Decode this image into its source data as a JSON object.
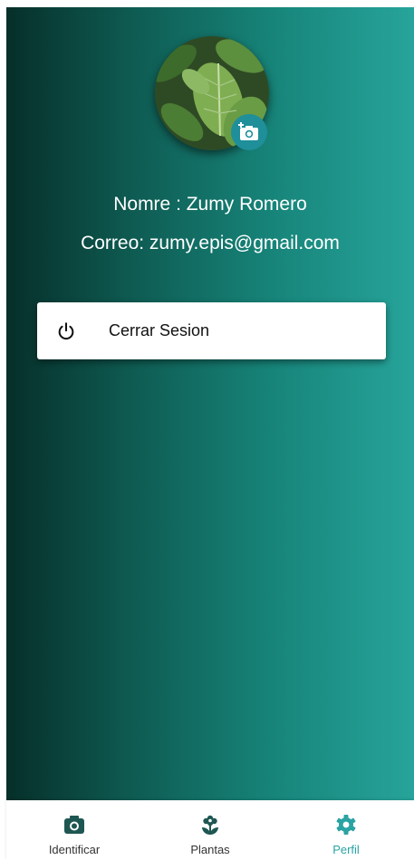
{
  "profile": {
    "avatar_icon": "leaf-photo",
    "change_photo_icon": "add-a-photo-icon",
    "name_line": "Nomre : Zumy Romero",
    "email_line": "Correo: zumy.epis@gmail.com"
  },
  "logout": {
    "icon": "power-icon",
    "label": "Cerrar Sesion"
  },
  "bottom_nav": {
    "items": [
      {
        "icon": "camera-icon",
        "label": "Identificar"
      },
      {
        "icon": "plant-icon",
        "label": "Plantas"
      },
      {
        "icon": "gear-icon",
        "label": "Perfil"
      }
    ],
    "active": "Perfil"
  },
  "colors": {
    "gradient_start": "#062f29",
    "gradient_end": "#27a49b",
    "accent": "#2aa3a3",
    "nav_icon": "#1e5752"
  }
}
